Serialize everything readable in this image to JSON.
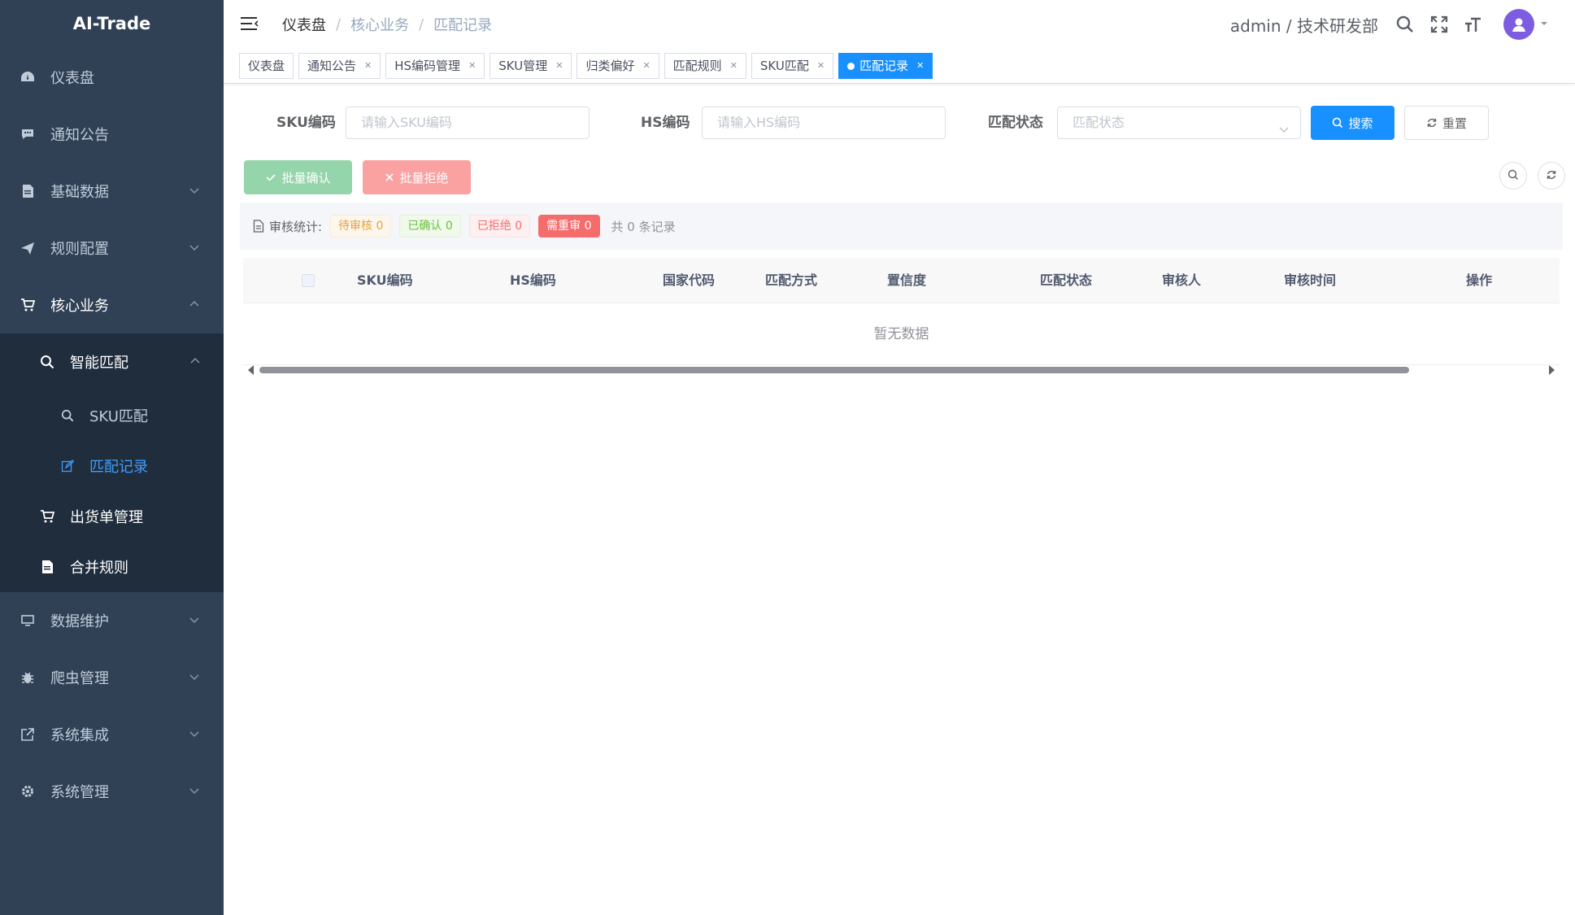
{
  "app": {
    "title": "AI-Trade"
  },
  "sidebar": {
    "items": [
      {
        "label": "仪表盘",
        "icon": "dashboard-icon"
      },
      {
        "label": "通知公告",
        "icon": "message-icon"
      },
      {
        "label": "基础数据",
        "icon": "document-icon"
      },
      {
        "label": "规则配置",
        "icon": "send-icon"
      },
      {
        "label": "核心业务",
        "icon": "cart-icon"
      },
      {
        "label": "数据维护",
        "icon": "monitor-icon"
      },
      {
        "label": "爬虫管理",
        "icon": "bug-icon"
      },
      {
        "label": "系统集成",
        "icon": "external-link-icon"
      },
      {
        "label": "系统管理",
        "icon": "gear-icon"
      }
    ],
    "core": {
      "smart_match": "智能匹配",
      "sku_match": "SKU匹配",
      "match_records": "匹配记录",
      "shipment": "出货单管理",
      "merge_rules": "合并规则"
    }
  },
  "navbar": {
    "breadcrumb": [
      "仪表盘",
      "核心业务",
      "匹配记录"
    ],
    "user": "admin / 技术研发部"
  },
  "tags": [
    {
      "label": "仪表盘",
      "closable": false
    },
    {
      "label": "通知公告",
      "closable": true
    },
    {
      "label": "HS编码管理",
      "closable": true
    },
    {
      "label": "SKU管理",
      "closable": true
    },
    {
      "label": "归类偏好",
      "closable": true
    },
    {
      "label": "匹配规则",
      "closable": true
    },
    {
      "label": "SKU匹配",
      "closable": true
    },
    {
      "label": "匹配记录",
      "closable": true,
      "active": true
    }
  ],
  "filters": {
    "sku_label": "SKU编码",
    "sku_placeholder": "请输入SKU编码",
    "hs_label": "HS编码",
    "hs_placeholder": "请输入HS编码",
    "status_label": "匹配状态",
    "status_placeholder": "匹配状态",
    "search_button": "搜索",
    "reset_button": "重置"
  },
  "toolbar": {
    "batch_confirm": "批量确认",
    "batch_reject": "批量拒绝"
  },
  "stats": {
    "label": "审核统计:",
    "pending": "待审核 0",
    "confirmed": "已确认 0",
    "rejected": "已拒绝 0",
    "re_review": "需重审 0",
    "total": "共 0 条记录"
  },
  "table": {
    "columns": [
      "SKU编码",
      "HS编码",
      "国家代码",
      "匹配方式",
      "置信度",
      "匹配状态",
      "审核人",
      "审核时间",
      "操作"
    ],
    "empty_text": "暂无数据"
  },
  "colors": {
    "sidebar_bg": "#304156",
    "submenu_bg": "#1f2d3d",
    "primary": "#1890ff",
    "success_light": "#95d5ab",
    "danger_light": "#faa1a1",
    "danger": "#f56c6c"
  }
}
